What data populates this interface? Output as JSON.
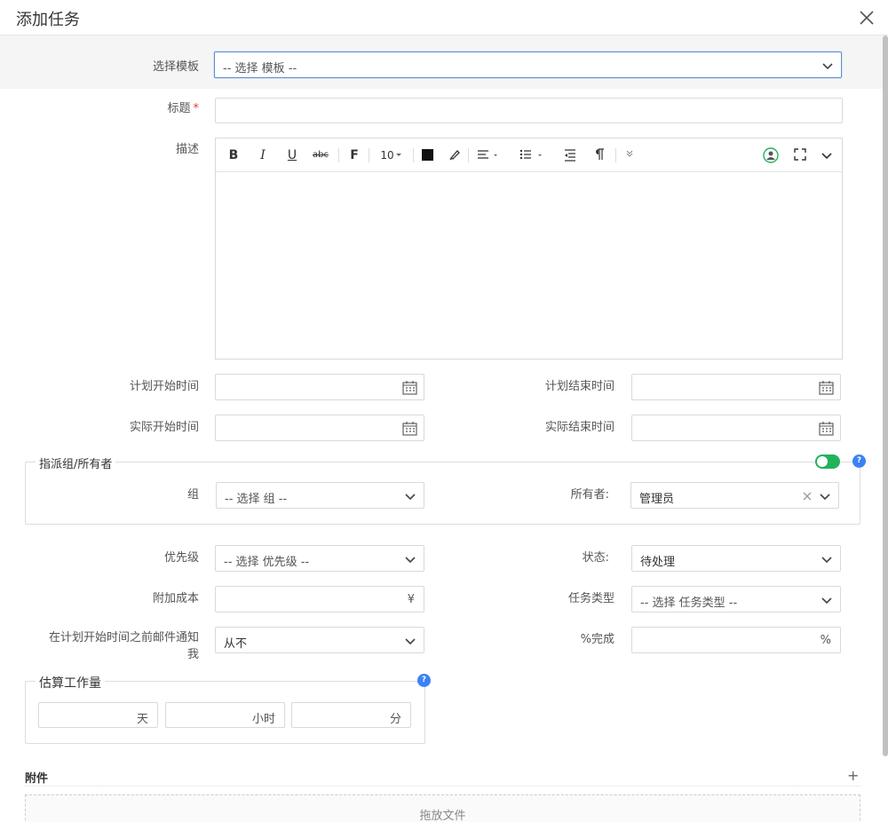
{
  "dialog": {
    "title": "添加任务"
  },
  "template": {
    "label": "选择模板",
    "value": "-- 选择 模板 --"
  },
  "title_field": {
    "label": "标题",
    "required_mark": "*",
    "value": ""
  },
  "description": {
    "label": "描述",
    "toolbar": {
      "bold": "B",
      "italic": "I",
      "underline": "U",
      "strike": "abc",
      "font": "F",
      "font_size": "10"
    }
  },
  "dates": {
    "plan_start_label": "计划开始时间",
    "plan_end_label": "计划结束时间",
    "actual_start_label": "实际开始时间",
    "actual_end_label": "实际结束时间"
  },
  "assign": {
    "legend": "指派组/所有者",
    "group_label": "组",
    "group_value": "-- 选择 组 --",
    "owner_label": "所有者:",
    "owner_value": "管理员",
    "toggle_on": true,
    "help": "?"
  },
  "priority": {
    "label": "优先级",
    "value": "-- 选择 优先级 --"
  },
  "status": {
    "label": "状态:",
    "value": "待处理"
  },
  "cost": {
    "label": "附加成本",
    "suffix": "¥"
  },
  "task_type": {
    "label": "任务类型",
    "value": "-- 选择 任务类型 --"
  },
  "notify": {
    "label_line1": "在计划开始时间之前邮件通知",
    "label_line2": "我",
    "value": "从不"
  },
  "percent": {
    "label": "%完成",
    "suffix": "%"
  },
  "estimate": {
    "legend": "估算工作量",
    "days_unit": "天",
    "hours_unit": "小时",
    "minutes_unit": "分",
    "help": "?"
  },
  "attachments": {
    "title": "附件",
    "add": "+",
    "dropzone": "拖放文件"
  },
  "colors": {
    "accent": "#3b82f6",
    "toggle": "#21b35a",
    "required": "#e4393c"
  }
}
